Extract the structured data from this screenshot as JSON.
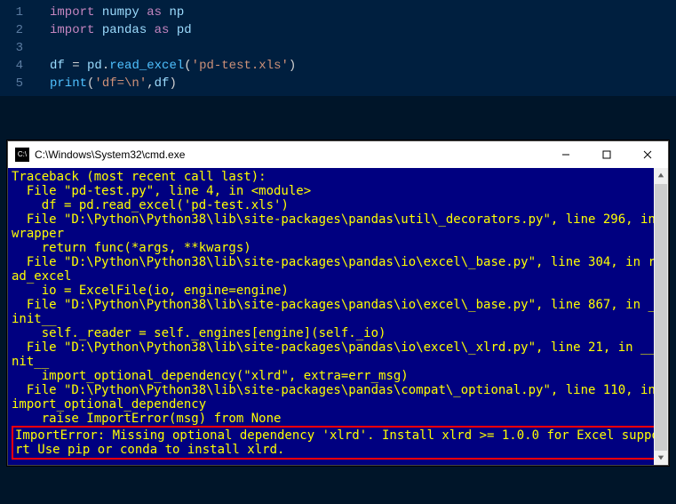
{
  "editor": {
    "lines": [
      {
        "n": "1",
        "seg": [
          {
            "t": "import ",
            "c": "kw"
          },
          {
            "t": "numpy",
            "c": "var"
          },
          {
            "t": " as ",
            "c": "kw"
          },
          {
            "t": "np",
            "c": "var"
          }
        ]
      },
      {
        "n": "2",
        "seg": [
          {
            "t": "import ",
            "c": "kw"
          },
          {
            "t": "pandas",
            "c": "var"
          },
          {
            "t": " as ",
            "c": "kw"
          },
          {
            "t": "pd",
            "c": "var"
          }
        ]
      },
      {
        "n": "3",
        "seg": []
      },
      {
        "n": "4",
        "seg": [
          {
            "t": "df",
            "c": "var"
          },
          {
            "t": " = ",
            "c": "op"
          },
          {
            "t": "pd",
            "c": "var"
          },
          {
            "t": ".",
            "c": "punct"
          },
          {
            "t": "read_excel",
            "c": "fn"
          },
          {
            "t": "(",
            "c": "punct"
          },
          {
            "t": "'pd-test.xls'",
            "c": "str"
          },
          {
            "t": ")",
            "c": "punct"
          }
        ]
      },
      {
        "n": "5",
        "seg": [
          {
            "t": "print",
            "c": "fn"
          },
          {
            "t": "(",
            "c": "punct"
          },
          {
            "t": "'df=",
            "c": "str"
          },
          {
            "t": "\\n",
            "c": "str"
          },
          {
            "t": "'",
            "c": "str"
          },
          {
            "t": ",",
            "c": "punct"
          },
          {
            "t": "df",
            "c": "var"
          },
          {
            "t": ")",
            "c": "punct"
          }
        ]
      }
    ]
  },
  "terminal": {
    "title": "C:\\Windows\\System32\\cmd.exe",
    "icon_glyph": "C:\\",
    "traceback": [
      "Traceback (most recent call last):",
      "  File \"pd-test.py\", line 4, in <module>",
      "    df = pd.read_excel('pd-test.xls')",
      "  File \"D:\\Python\\Python38\\lib\\site-packages\\pandas\\util\\_decorators.py\", line 296, in wrapper",
      "    return func(*args, **kwargs)",
      "  File \"D:\\Python\\Python38\\lib\\site-packages\\pandas\\io\\excel\\_base.py\", line 304, in read_excel",
      "    io = ExcelFile(io, engine=engine)",
      "  File \"D:\\Python\\Python38\\lib\\site-packages\\pandas\\io\\excel\\_base.py\", line 867, in __init__",
      "    self._reader = self._engines[engine](self._io)",
      "  File \"D:\\Python\\Python38\\lib\\site-packages\\pandas\\io\\excel\\_xlrd.py\", line 21, in __init__",
      "    import_optional_dependency(\"xlrd\", extra=err_msg)",
      "  File \"D:\\Python\\Python38\\lib\\site-packages\\pandas\\compat\\_optional.py\", line 110, in import_optional_dependency",
      "    raise ImportError(msg) from None"
    ],
    "error_box": "ImportError: Missing optional dependency 'xlrd'. Install xlrd >= 1.0.0 for Excel support Use pip or conda to install xlrd."
  }
}
